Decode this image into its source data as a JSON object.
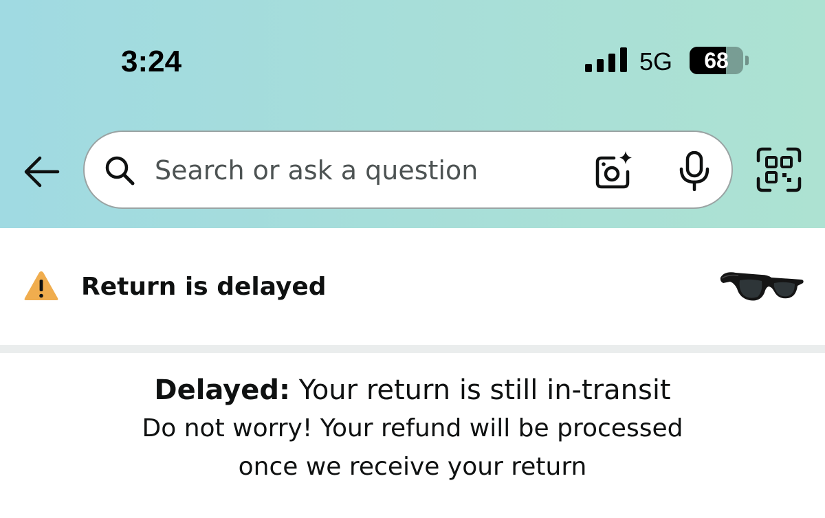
{
  "status_bar": {
    "time": "3:24",
    "network": "5G",
    "battery": "68",
    "battery_level": 0.68
  },
  "search": {
    "placeholder": "Search or ask a question"
  },
  "icons": {
    "back": "arrow-left-icon",
    "search": "search-icon",
    "camera": "camera-sparkle-icon",
    "mic": "microphone-icon",
    "scan": "qr-scan-icon",
    "warning": "warning-triangle-icon",
    "product": "sunglasses-product-image"
  },
  "alert": {
    "title": "Return is delayed"
  },
  "message": {
    "label": "Delayed:",
    "status": " Your return is still in-transit",
    "detail_line1": "Do not worry! Your refund will be processed",
    "detail_line2": "once we receive your return"
  },
  "colors": {
    "header_gradient_start": "#a0dae2",
    "header_gradient_end": "#ade2d2",
    "warning": "#f0ad4e",
    "divider": "#eaeded",
    "text": "#0f1111"
  }
}
